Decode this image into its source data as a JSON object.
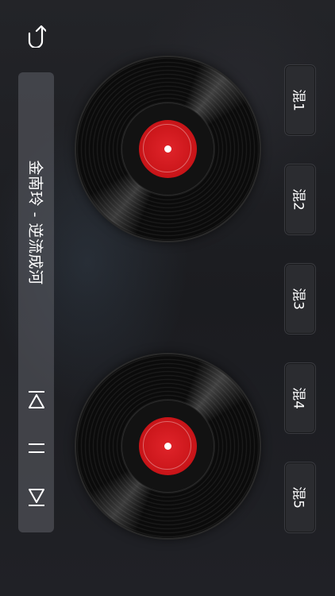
{
  "header": {
    "back_icon": "undo-arrow-icon"
  },
  "player": {
    "song_title": "金南玲 - 逆流成河",
    "controls": [
      {
        "name": "previous-button",
        "icon": "previous-icon"
      },
      {
        "name": "pause-button",
        "icon": "pause-icon"
      },
      {
        "name": "next-button",
        "icon": "next-icon"
      }
    ]
  },
  "turntables": [
    {
      "label_color": "#d81e22"
    },
    {
      "label_color": "#d81e22"
    }
  ],
  "mix_buttons": [
    {
      "label": "混1"
    },
    {
      "label": "混2"
    },
    {
      "label": "混3"
    },
    {
      "label": "混4"
    },
    {
      "label": "混5"
    }
  ]
}
